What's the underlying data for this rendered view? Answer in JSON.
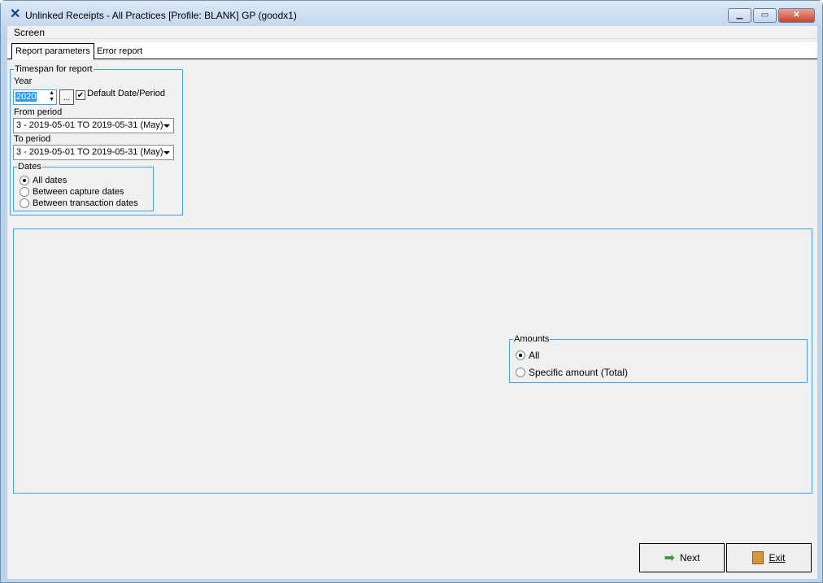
{
  "window": {
    "title": "Unlinked Receipts - All Practices  [Profile: BLANK] GP (goodx1)",
    "min": "▁",
    "max": "▭",
    "close": "✕"
  },
  "menu": {
    "screen": "Screen"
  },
  "tabs": [
    {
      "label": "Report parameters"
    },
    {
      "label": "Error report"
    }
  ],
  "timespan": {
    "legend": "Timespan for report",
    "year_label": "Year",
    "year_value": "2020",
    "browse": "...",
    "default_label": "Default Date/Period",
    "default_checked": true,
    "from_label": "From period",
    "from_value": "3  - 2019-05-01 TO 2019-05-31 (May)",
    "to_label": "To period",
    "to_value": "3  - 2019-05-01 TO 2019-05-31 (May)"
  },
  "dates": {
    "legend": "Dates",
    "options": [
      "All dates",
      "Between capture dates",
      "Between transaction dates"
    ],
    "selected": 0
  },
  "amounts": {
    "legend": "Amounts",
    "options": [
      "All",
      "Specific amount (Total)"
    ],
    "selected": 0
  },
  "buttons": {
    "next": "Next",
    "exit": "Exit"
  }
}
